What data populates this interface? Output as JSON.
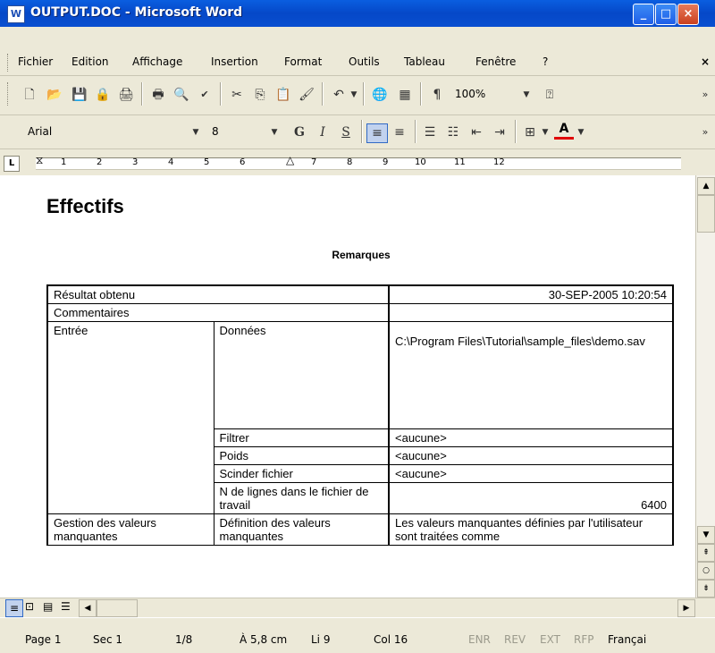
{
  "window": {
    "title": "OUTPUT.DOC - Microsoft Word",
    "app_icon_letter": "W"
  },
  "titlebar_buttons": {
    "minimize": "_",
    "maximize": "□",
    "close": "×"
  },
  "menu": {
    "items": [
      "Fichier",
      "Edition",
      "Affichage",
      "Insertion",
      "Format",
      "Outils",
      "Tableau",
      "Fenêtre",
      "?"
    ],
    "close_glyph": "×"
  },
  "standard_toolbar": {
    "icons": [
      "new-doc-icon",
      "open-icon",
      "save-icon",
      "permission-icon",
      "print-preview-icon",
      "print-icon",
      "preview-icon",
      "spelling-icon",
      "cut-icon",
      "copy-icon",
      "paste-icon",
      "format-painter-icon",
      "undo-icon",
      "hyperlink-icon",
      "table-icon",
      "pilcrow-icon",
      "help-icon"
    ],
    "zoom": "100%"
  },
  "format_toolbar": {
    "font": "Arial",
    "size": "8",
    "bold": "G",
    "italic": "I",
    "underline": "S",
    "font_color": "A"
  },
  "ruler": {
    "numbers": [
      "1",
      "2",
      "3",
      "4",
      "5",
      "6",
      "7",
      "8",
      "9",
      "10",
      "11",
      "12"
    ]
  },
  "document": {
    "heading": "Effectifs",
    "subheading": "Remarques",
    "rows": [
      {
        "label": "Résultat obtenu",
        "value": "30-SEP-2005 10:20:54"
      },
      {
        "label": "Commentaires",
        "value": ""
      },
      {
        "group": "Entrée",
        "sub": "Données",
        "value": "C:\\Program Files\\Tutorial\\sample_files\\demo.sav"
      },
      {
        "sub": "Filtrer",
        "value": "<aucune>"
      },
      {
        "sub": "Poids",
        "value": "<aucune>"
      },
      {
        "sub": "Scinder fichier",
        "value": "<aucune>"
      },
      {
        "sub": "N de lignes dans le fichier de travail",
        "value": "6400"
      },
      {
        "group": "Gestion des valeurs manquantes",
        "sub": "Définition des valeurs manquantes",
        "value": "Les valeurs manquantes définies par l'utilisateur sont traitées comme"
      }
    ]
  },
  "statusbar": {
    "page": "Page 1",
    "section": "Sec 1",
    "pages": "1/8",
    "position": "À 5,8 cm",
    "line": "Li 9",
    "col": "Col 16",
    "enr": "ENR",
    "rev": "REV",
    "ext": "EXT",
    "rfp": "RFP",
    "language": "Françai"
  }
}
